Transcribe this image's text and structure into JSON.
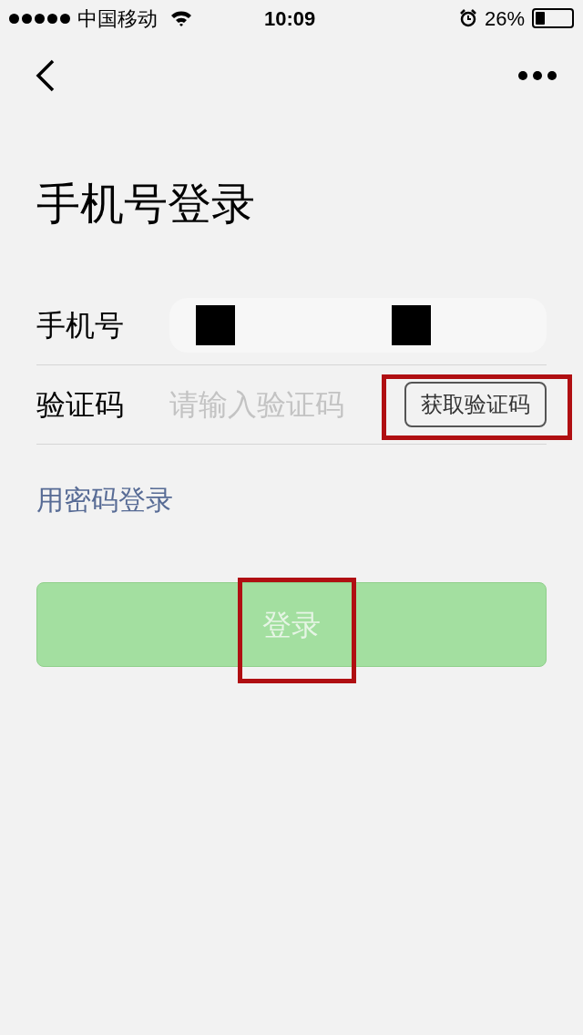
{
  "status_bar": {
    "carrier": "中国移动",
    "time": "10:09",
    "battery": "26%"
  },
  "title": "手机号登录",
  "fields": [
    {
      "label": "手机号",
      "kind": "phone"
    },
    {
      "label": "验证码",
      "placeholder": "请输入验证码",
      "button": "获取验证码",
      "kind": "code"
    }
  ],
  "password_link": "用密码登录",
  "login_button": {
    "label": "登录",
    "disabled": true
  }
}
